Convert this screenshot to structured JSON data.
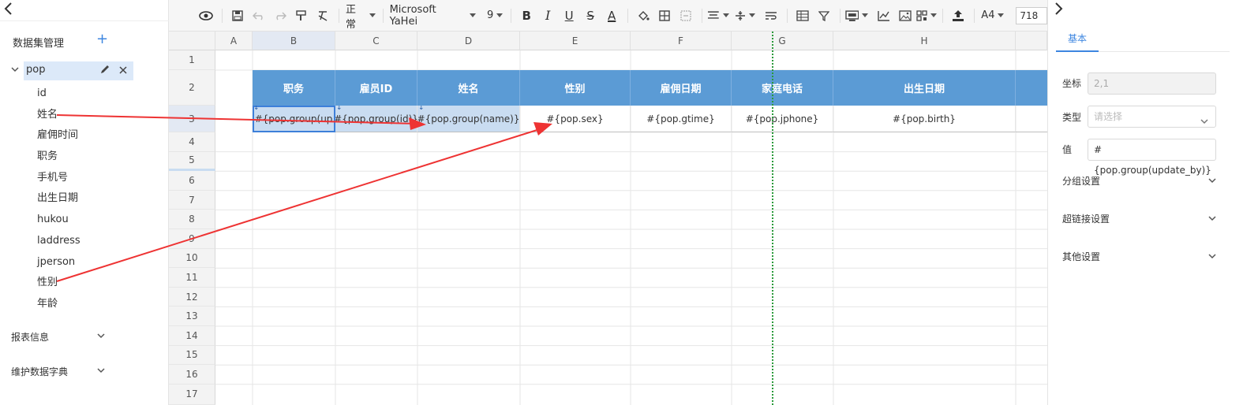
{
  "left": {
    "dataset_header": "数据集管理",
    "add_glyph": "+",
    "dataset_name": "pop",
    "fields": [
      "id",
      "姓名",
      "雇佣时间",
      "职务",
      "手机号",
      "出生日期",
      "hukou",
      "laddress",
      "jperson",
      "性别",
      "年龄"
    ],
    "sections": [
      "报表信息",
      "维护数据字典"
    ]
  },
  "toolbar": {
    "style_select": "正常",
    "font_select": "Microsoft YaHei",
    "size_select": "9",
    "paper_select": "A4",
    "zoom_value": "718",
    "bold_glyph": "B",
    "italic_glyph": "I",
    "underline_glyph": "U",
    "strike_glyph": "S",
    "fontcolor_glyph": "A"
  },
  "grid": {
    "columns": [
      "A",
      "B",
      "C",
      "D",
      "E",
      "F",
      "G",
      "H"
    ],
    "rows": [
      "1",
      "2",
      "3",
      "4",
      "5",
      "6",
      "7",
      "8",
      "9",
      "10",
      "11",
      "12",
      "13",
      "14",
      "15",
      "16",
      "17"
    ],
    "headers": [
      "职务",
      "雇员ID",
      "姓名",
      "性别",
      "雇佣日期",
      "家庭电话",
      "出生日期"
    ],
    "values": [
      "#{pop.group(up",
      "#{pop.group(id)}",
      "#{pop.group(name)}",
      "#{pop.sex}",
      "#{pop.gtime}",
      "#{pop.jphone}",
      "#{pop.birth}"
    ],
    "marker_glyph": "↓"
  },
  "right": {
    "tab_basic": "基本",
    "coord_label": "坐标",
    "coord_value": "2,1",
    "type_label": "类型",
    "type_placeholder": "请选择",
    "value_label": "值",
    "value_text": "#{pop.group(update_by)}",
    "sections": [
      "分组设置",
      "超链接设置",
      "其他设置"
    ]
  },
  "colors": {
    "header_fill": "#5b9bd5",
    "selected_fill": "#c9dcf1",
    "accent": "#3d86e0",
    "arrow": "#ee3333",
    "page_break": "#2a9a3a"
  }
}
